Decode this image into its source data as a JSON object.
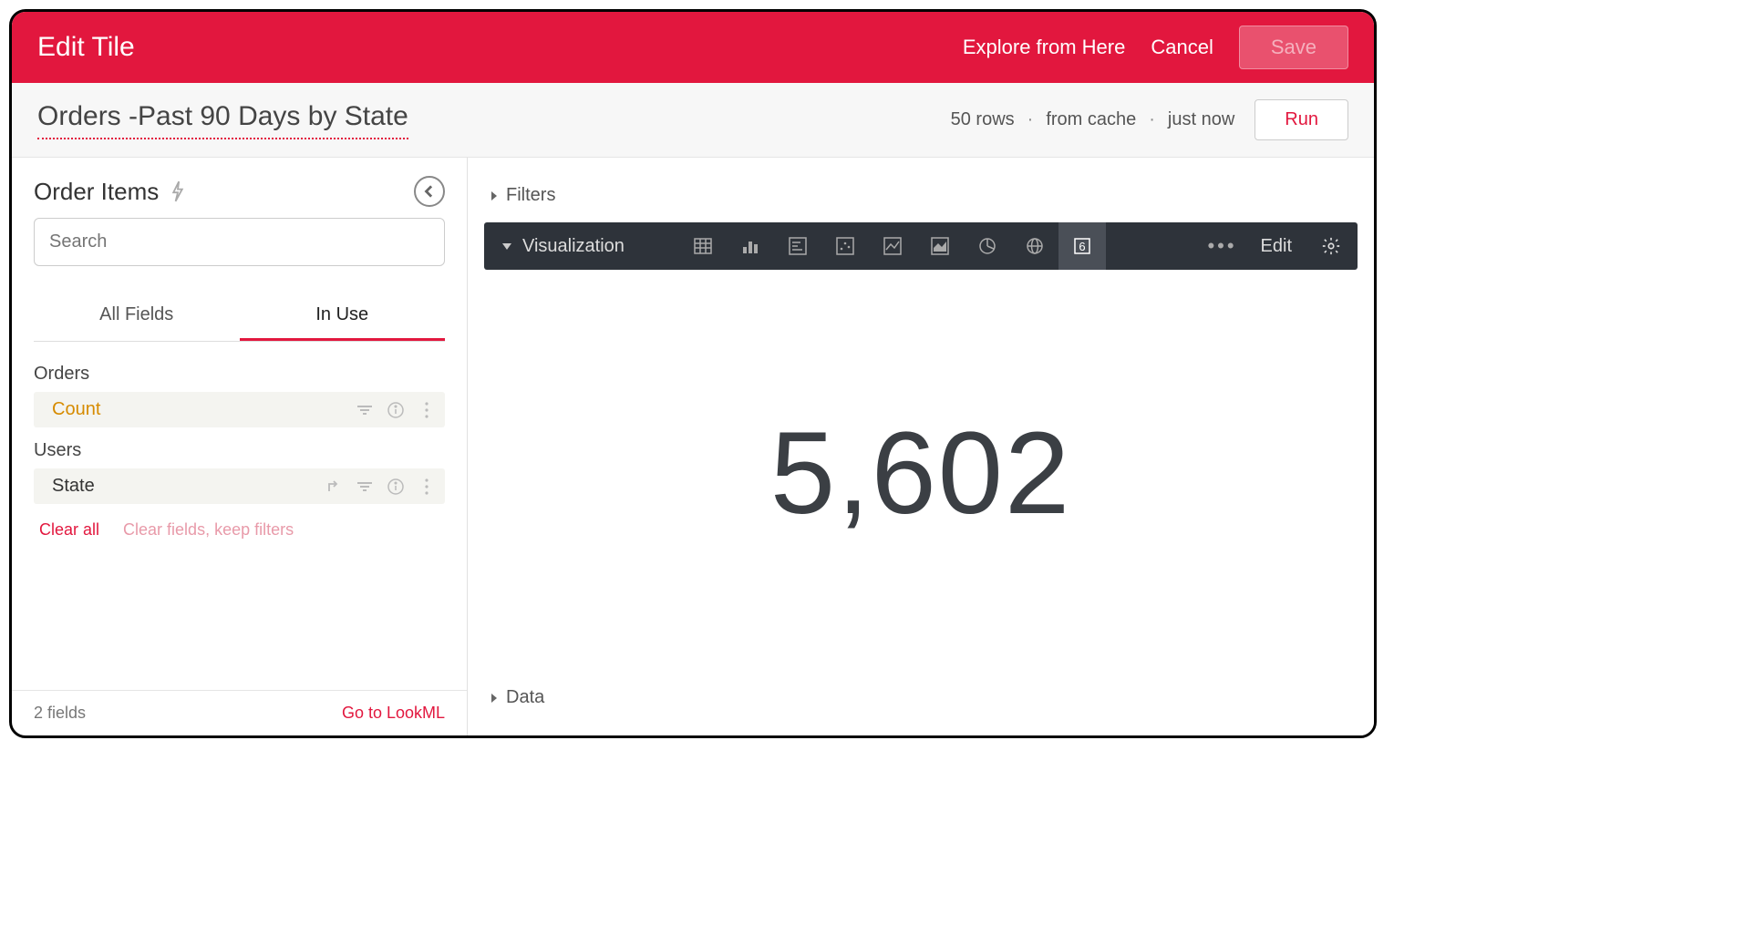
{
  "header": {
    "title": "Edit Tile",
    "explore_from_here": "Explore from Here",
    "cancel": "Cancel",
    "save": "Save"
  },
  "subheader": {
    "tile_title": "Orders -Past 90 Days by State",
    "rows": "50 rows",
    "cache": "from cache",
    "time": "just now",
    "run": "Run"
  },
  "sidebar": {
    "explore_name": "Order Items",
    "search_placeholder": "Search",
    "tabs": {
      "all": "All Fields",
      "in_use": "In Use"
    },
    "views": {
      "orders_label": "Orders",
      "orders_field": "Count",
      "users_label": "Users",
      "users_field": "State"
    },
    "clear_all": "Clear all",
    "clear_keep": "Clear fields, keep filters",
    "field_count": "2 fields",
    "go_lookml": "Go to LookML"
  },
  "sections": {
    "filters": "Filters",
    "visualization": "Visualization",
    "data": "Data",
    "vis_edit": "Edit",
    "single_value_label": "6"
  },
  "visualization": {
    "value": "5,602"
  }
}
